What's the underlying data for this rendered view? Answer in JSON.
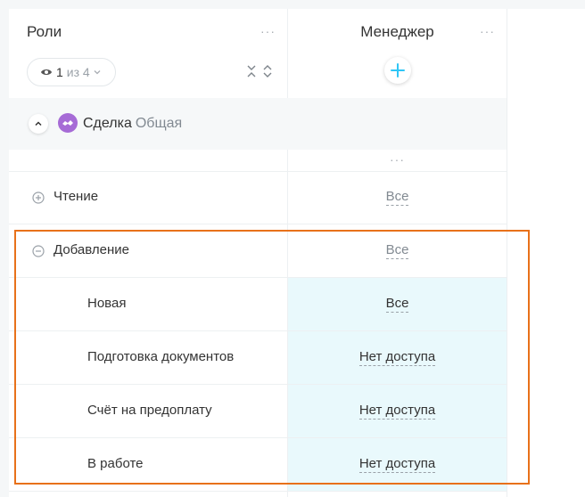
{
  "header": {
    "roles_title": "Роли",
    "menu_dots": "···",
    "filter": {
      "current": "1",
      "of_total": "из 4"
    },
    "manager_column": "Менеджер"
  },
  "section": {
    "name": "Сделка",
    "subtitle": "Общая",
    "more_dots": "···"
  },
  "rows": [
    {
      "label": "Чтение",
      "value": "Все",
      "expand": "plus"
    },
    {
      "label": "Добавление",
      "value": "Все",
      "expand": "minus"
    },
    {
      "label": "Новая",
      "value": "Все"
    },
    {
      "label": "Подготовка документов",
      "value": "Нет доступа"
    },
    {
      "label": "Счёт на предоплату",
      "value": "Нет доступа"
    },
    {
      "label": "В работе",
      "value": "Нет доступа"
    }
  ],
  "colors": {
    "accent": "#2fc6f6",
    "highlight_cell": "#e9f9fc",
    "annotation_border": "#e8711a",
    "section_icon": "#a66bd6"
  },
  "icons": {
    "eye": "eye-icon",
    "chevron": "chevron-down-icon",
    "collapse": "collapse-expand-icon",
    "add": "plus-icon",
    "section": "handshake-icon"
  }
}
